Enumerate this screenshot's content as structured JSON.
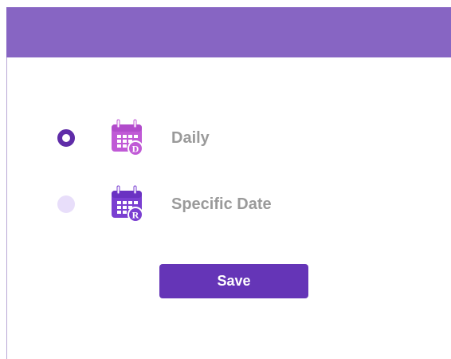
{
  "header": {
    "color": "#8765c3"
  },
  "schedule_options": [
    {
      "label": "Daily",
      "selected": true,
      "icon": "calendar-daily-icon",
      "icon_badge": "D",
      "icon_color": "#c05ad6"
    },
    {
      "label": "Specific Date",
      "selected": false,
      "icon": "calendar-specific-date-icon",
      "icon_badge": "R",
      "icon_color": "#7a3fd1"
    }
  ],
  "actions": {
    "save_label": "Save",
    "save_color": "#6535b7"
  },
  "colors": {
    "radio_checked": "#5f2ca8",
    "radio_unchecked": "#e8defa",
    "label_text": "#9a9a9a"
  }
}
